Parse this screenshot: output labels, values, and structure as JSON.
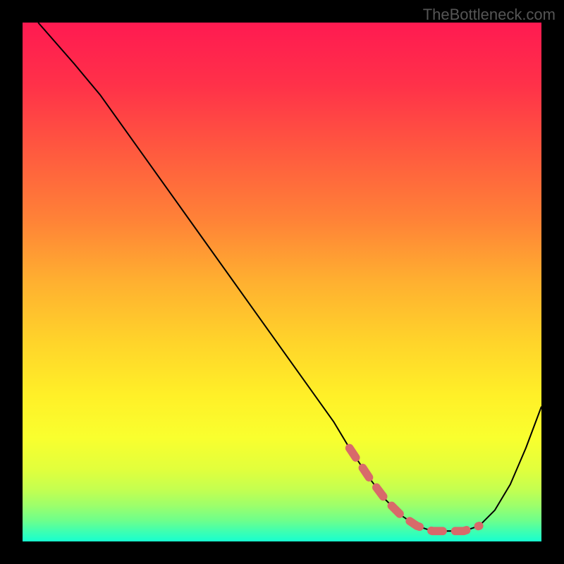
{
  "watermark": "TheBottleneck.com",
  "chart_data": {
    "type": "line",
    "title": "",
    "xlabel": "",
    "ylabel": "",
    "xlim": [
      0,
      100
    ],
    "ylim": [
      0,
      100
    ],
    "series": [
      {
        "name": "curve",
        "x": [
          3,
          10,
          15,
          20,
          25,
          30,
          35,
          40,
          45,
          50,
          55,
          60,
          63,
          67,
          70,
          73,
          76,
          79,
          82,
          85,
          88,
          91,
          94,
          97,
          100
        ],
        "y": [
          100,
          92,
          86,
          79,
          72,
          65,
          58,
          51,
          44,
          37,
          30,
          23,
          18,
          12,
          8,
          5,
          3,
          2,
          2,
          2,
          3,
          6,
          11,
          18,
          26
        ]
      },
      {
        "name": "optimal-band",
        "x": [
          63,
          67,
          70,
          73,
          76,
          79,
          82,
          85,
          88
        ],
        "y": [
          18,
          12,
          8,
          5,
          3,
          2,
          2,
          2,
          3
        ]
      }
    ],
    "background": {
      "type": "vertical-gradient",
      "stops": [
        {
          "pos": 0.0,
          "color": "#ff1a51"
        },
        {
          "pos": 0.12,
          "color": "#ff3149"
        },
        {
          "pos": 0.25,
          "color": "#ff5a3f"
        },
        {
          "pos": 0.38,
          "color": "#ff8237"
        },
        {
          "pos": 0.5,
          "color": "#ffb030"
        },
        {
          "pos": 0.62,
          "color": "#ffd52a"
        },
        {
          "pos": 0.72,
          "color": "#fff028"
        },
        {
          "pos": 0.8,
          "color": "#f9ff2e"
        },
        {
          "pos": 0.86,
          "color": "#e2ff3c"
        },
        {
          "pos": 0.9,
          "color": "#c4ff50"
        },
        {
          "pos": 0.93,
          "color": "#9eff6a"
        },
        {
          "pos": 0.96,
          "color": "#6dff8c"
        },
        {
          "pos": 0.98,
          "color": "#3fffb0"
        },
        {
          "pos": 1.0,
          "color": "#17ffd0"
        }
      ]
    },
    "colors": {
      "curve": "#000000",
      "optimal": "#d86a6a"
    }
  }
}
